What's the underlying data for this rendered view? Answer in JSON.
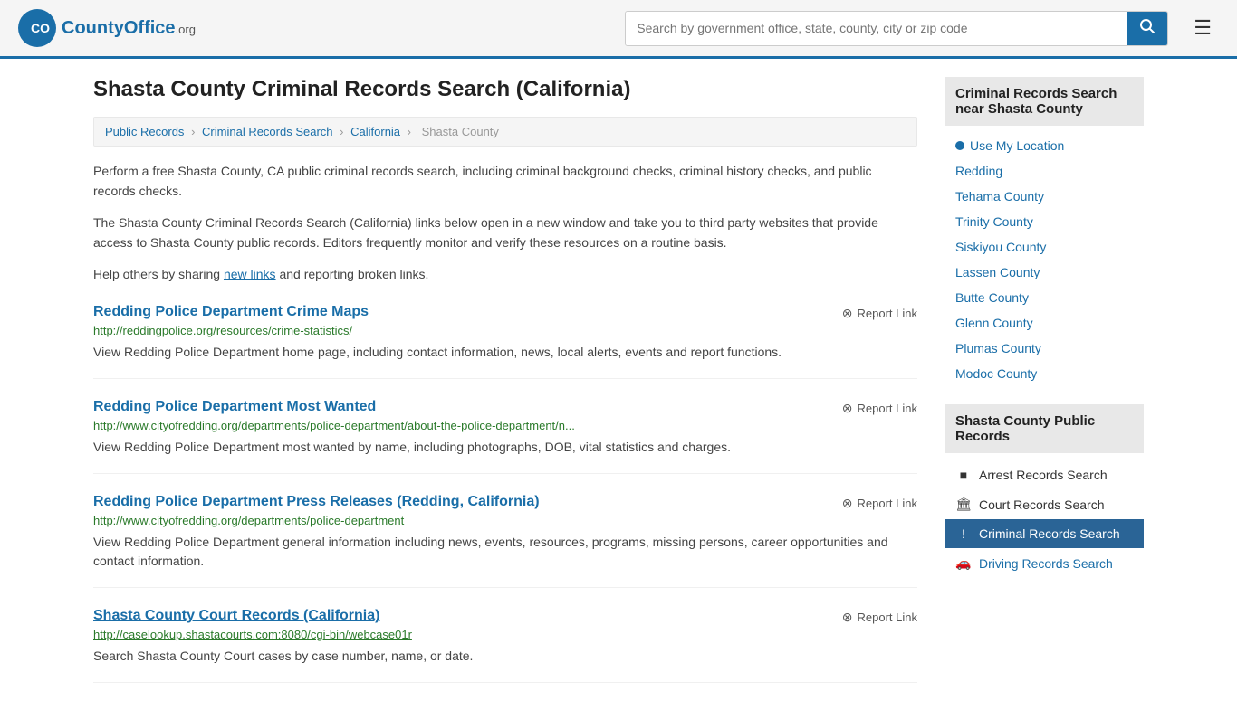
{
  "header": {
    "logo_text": "CountyOffice",
    "logo_org": ".org",
    "search_placeholder": "Search by government office, state, county, city or zip code",
    "search_value": ""
  },
  "page": {
    "title": "Shasta County Criminal Records Search (California)",
    "breadcrumbs": [
      {
        "label": "Public Records",
        "url": "#"
      },
      {
        "label": "Criminal Records Search",
        "url": "#"
      },
      {
        "label": "California",
        "url": "#"
      },
      {
        "label": "Shasta County",
        "url": "#"
      }
    ],
    "desc1": "Perform a free Shasta County, CA public criminal records search, including criminal background checks, criminal history checks, and public records checks.",
    "desc2": "The Shasta County Criminal Records Search (California) links below open in a new window and take you to third party websites that provide access to Shasta County public records. Editors frequently monitor and verify these resources on a routine basis.",
    "desc3_prefix": "Help others by sharing ",
    "desc3_link": "new links",
    "desc3_suffix": " and reporting broken links.",
    "results": [
      {
        "title": "Redding Police Department Crime Maps",
        "url": "http://reddingpolice.org/resources/crime-statistics/",
        "desc": "View Redding Police Department home page, including contact information, news, local alerts, events and report functions.",
        "report": "Report Link"
      },
      {
        "title": "Redding Police Department Most Wanted",
        "url": "http://www.cityofredding.org/departments/police-department/about-the-police-department/n...",
        "desc": "View Redding Police Department most wanted by name, including photographs, DOB, vital statistics and charges.",
        "report": "Report Link"
      },
      {
        "title": "Redding Police Department Press Releases (Redding, California)",
        "url": "http://www.cityofredding.org/departments/police-department",
        "desc": "View Redding Police Department general information including news, events, resources, programs, missing persons, career opportunities and contact information.",
        "report": "Report Link"
      },
      {
        "title": "Shasta County Court Records (California)",
        "url": "http://caselookup.shastacourts.com:8080/cgi-bin/webcase01r",
        "desc": "Search Shasta County Court cases by case number, name, or date.",
        "report": "Report Link"
      }
    ]
  },
  "sidebar": {
    "nearby_header": "Criminal Records Search near Shasta County",
    "use_location": "Use My Location",
    "nearby_links": [
      "Redding",
      "Tehama County",
      "Trinity County",
      "Siskiyou County",
      "Lassen County",
      "Butte County",
      "Glenn County",
      "Plumas County",
      "Modoc County"
    ],
    "public_records_header": "Shasta County Public Records",
    "public_records": [
      {
        "label": "Arrest Records Search",
        "icon": "■",
        "active": false
      },
      {
        "label": "Court Records Search",
        "icon": "🏛",
        "active": false
      },
      {
        "label": "Criminal Records Search",
        "icon": "!",
        "active": true
      },
      {
        "label": "Driving Records Search",
        "icon": "🚗",
        "active": false
      }
    ]
  }
}
